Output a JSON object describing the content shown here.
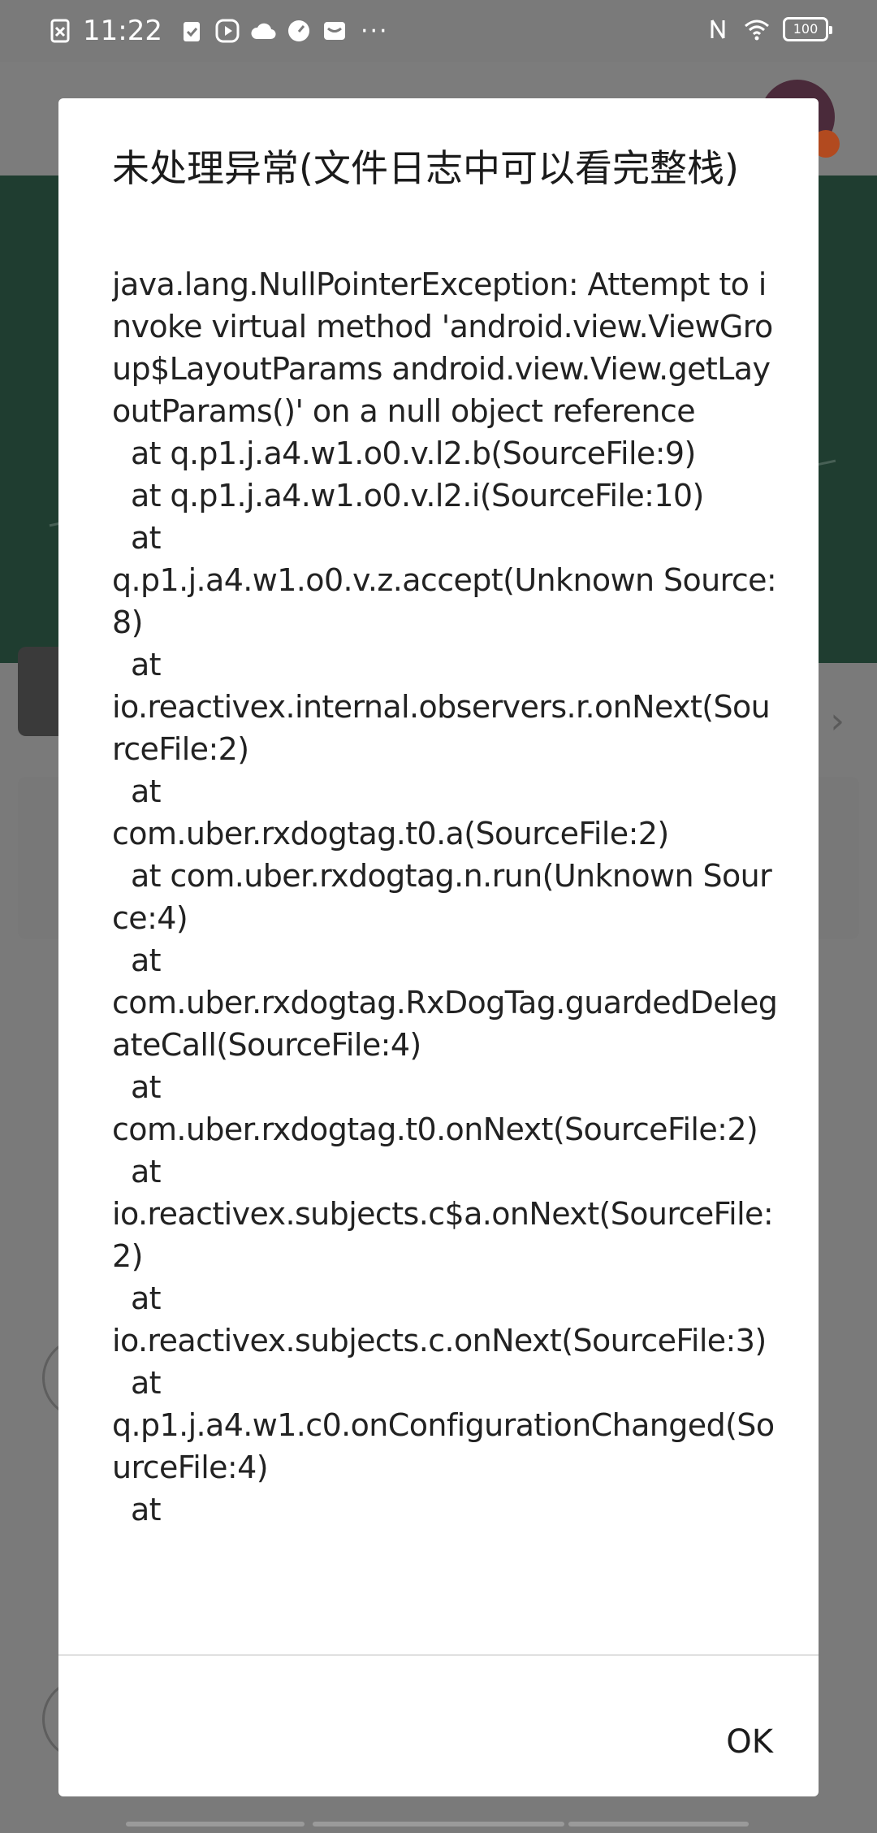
{
  "status_bar": {
    "time": "11:22",
    "icons_left": [
      "sim-icon",
      "clipboard-icon",
      "play-icon",
      "cloud-icon",
      "gauge-icon",
      "mail-icon"
    ],
    "overflow": "···",
    "icons_right": [
      "nfc-icon",
      "wifi-icon"
    ],
    "battery": "100"
  },
  "dialog": {
    "title": "未处理异常(文件日志中可以看完整栈)",
    "message": "java.lang.NullPointerException: Attempt to invoke virtual method 'android.view.ViewGroup$LayoutParams android.view.View.getLayoutParams()' on a null object reference\n  at q.p1.j.a4.w1.o0.v.l2.b(SourceFile:9)\n  at q.p1.j.a4.w1.o0.v.l2.i(SourceFile:10)\n  at\nq.p1.j.a4.w1.o0.v.z.accept(Unknown Source:8)\n  at\nio.reactivex.internal.observers.r.onNext(SourceFile:2)\n  at\ncom.uber.rxdogtag.t0.a(SourceFile:2)\n  at com.uber.rxdogtag.n.run(Unknown Source:4)\n  at\ncom.uber.rxdogtag.RxDogTag.guardedDelegateCall(SourceFile:4)\n  at\ncom.uber.rxdogtag.t0.onNext(SourceFile:2)\n  at\nio.reactivex.subjects.c$a.onNext(SourceFile:2)\n  at\nio.reactivex.subjects.c.onNext(SourceFile:3)\n  at\nq.p1.j.a4.w1.c0.onConfigurationChanged(SourceFile:4)\n  at",
    "ok_label": "OK"
  },
  "colors": {
    "scrim": "#7a7a7a",
    "banner": "#1f3d30",
    "dialog_bg": "#ffffff",
    "text": "#222222"
  }
}
